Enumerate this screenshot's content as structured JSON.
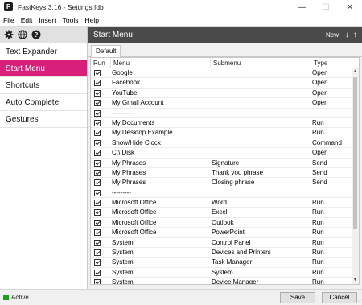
{
  "window": {
    "title": "FastKeys 3.16  -  Settings.fdb",
    "app_icon": "F",
    "controls": [
      "—",
      "☐",
      "✕"
    ]
  },
  "menubar": [
    "File",
    "Edit",
    "Insert",
    "Tools",
    "Help"
  ],
  "sidebar": {
    "toolbar_icons": [
      "gear-icon",
      "globe-icon",
      "help-icon"
    ],
    "items": [
      {
        "label": "Text Expander",
        "active": false
      },
      {
        "label": "Start Menu",
        "active": true
      },
      {
        "label": "Shortcuts",
        "active": false
      },
      {
        "label": "Auto Complete",
        "active": false
      },
      {
        "label": "Gestures",
        "active": false
      }
    ]
  },
  "main": {
    "title": "Start Menu",
    "new_label": "New",
    "down_arrow": "↓",
    "up_arrow": "↑",
    "tab": "Default"
  },
  "table": {
    "headers": {
      "run": "Run",
      "menu": "Menu",
      "submenu": "Submenu",
      "type": "Type"
    },
    "rows": [
      {
        "menu": "Google",
        "submenu": "",
        "type": "Open"
      },
      {
        "menu": "Facebook",
        "submenu": "",
        "type": "Open"
      },
      {
        "menu": "YouTube",
        "submenu": "",
        "type": "Open"
      },
      {
        "menu": "My Gmail Account",
        "submenu": "",
        "type": "Open"
      },
      {
        "menu": "---------",
        "submenu": "",
        "type": ""
      },
      {
        "menu": "My Documents",
        "submenu": "",
        "type": "Run"
      },
      {
        "menu": "My Desktop Example",
        "submenu": "",
        "type": "Run"
      },
      {
        "menu": "Show/Hide Clock",
        "submenu": "",
        "type": "Command"
      },
      {
        "menu": "C:\\ Disk",
        "submenu": "",
        "type": "Open"
      },
      {
        "menu": "My Phrases",
        "submenu": "Signature",
        "type": "Send"
      },
      {
        "menu": "My Phrases",
        "submenu": "Thank you phrase",
        "type": "Send"
      },
      {
        "menu": "My Phrases",
        "submenu": "Closing phrase",
        "type": "Send"
      },
      {
        "menu": "---------",
        "submenu": "",
        "type": ""
      },
      {
        "menu": "Microsoft Office",
        "submenu": "Word",
        "type": "Run"
      },
      {
        "menu": "Microsoft Office",
        "submenu": "Excel",
        "type": "Run"
      },
      {
        "menu": "Microsoft Office",
        "submenu": "Outlook",
        "type": "Run"
      },
      {
        "menu": "Microsoft Office",
        "submenu": "PowerPoint",
        "type": "Run"
      },
      {
        "menu": "System",
        "submenu": "Control Panel",
        "type": "Run"
      },
      {
        "menu": "System",
        "submenu": "Devices and Printers",
        "type": "Run"
      },
      {
        "menu": "System",
        "submenu": "Task Manager",
        "type": "Run"
      },
      {
        "menu": "System",
        "submenu": "System",
        "type": "Run"
      },
      {
        "menu": "System",
        "submenu": "Device Manager",
        "type": "Run"
      }
    ]
  },
  "status": {
    "text": "Active",
    "indicator_color": "#1aa21a",
    "save_label": "Save",
    "cancel_label": "Cancel"
  },
  "colors": {
    "accent": "#d8207a",
    "header_bg": "#4a4a4a"
  }
}
